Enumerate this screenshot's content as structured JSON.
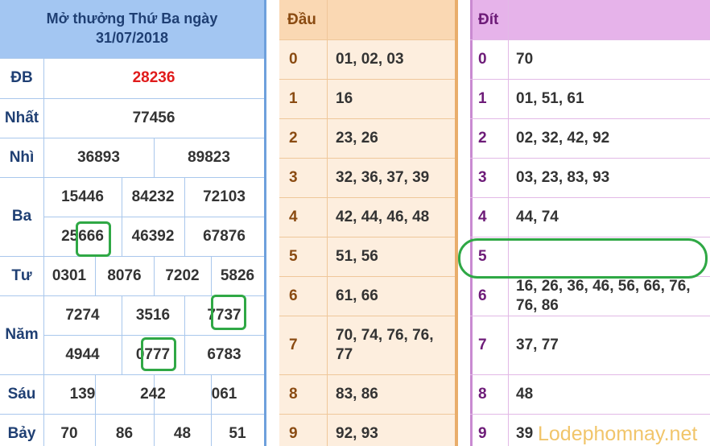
{
  "results": {
    "title_line1": "Mở thưởng Thứ Ba ngày",
    "title_line2": "31/07/2018",
    "special_label": "ĐB",
    "special_value": "28236",
    "first_label": "Nhất",
    "first_value": "77456",
    "second_label": "Nhì",
    "second_values": [
      "36893",
      "89823"
    ],
    "third_label": "Ba",
    "third_values": [
      "15446",
      "84232",
      "72103",
      "25666",
      "46392",
      "67876"
    ],
    "fourth_label": "Tư",
    "fourth_values": [
      "0301",
      "8076",
      "7202",
      "5826"
    ],
    "fifth_label": "Năm",
    "fifth_values": [
      "7274",
      "3516",
      "7737",
      "4944",
      "0777",
      "6783"
    ],
    "sixth_label": "Sáu",
    "sixth_values": [
      "139",
      "242",
      "061"
    ],
    "seventh_label": "Bảy",
    "seventh_values": [
      "70",
      "86",
      "48",
      "51"
    ],
    "special_color": "#e01b1b"
  },
  "dau": {
    "header": "Đầu",
    "rows": [
      {
        "k": "0",
        "v": "01, 02, 03"
      },
      {
        "k": "1",
        "v": "16"
      },
      {
        "k": "2",
        "v": "23, 26"
      },
      {
        "k": "3",
        "v": "32, 36, 37, 39"
      },
      {
        "k": "4",
        "v": "42, 44, 46, 48"
      },
      {
        "k": "5",
        "v": "51, 56"
      },
      {
        "k": "6",
        "v": "61, 66"
      },
      {
        "k": "7",
        "v": "70, 74, 76, 76,\n77"
      },
      {
        "k": "8",
        "v": "83, 86"
      },
      {
        "k": "9",
        "v": "92, 93"
      }
    ]
  },
  "dit": {
    "header": "Đít",
    "rows": [
      {
        "k": "0",
        "v": "70"
      },
      {
        "k": "1",
        "v": "01, 51, 61"
      },
      {
        "k": "2",
        "v": "02, 32, 42, 92"
      },
      {
        "k": "3",
        "v": "03, 23, 83, 93"
      },
      {
        "k": "4",
        "v": "44, 74"
      },
      {
        "k": "5",
        "v": ""
      },
      {
        "k": "6",
        "v": "16, 26, 36, 46, 56, 66, 76,\n76, 86"
      },
      {
        "k": "7",
        "v": "37, 77"
      },
      {
        "k": "8",
        "v": "48"
      },
      {
        "k": "9",
        "v": "39"
      }
    ]
  },
  "watermark": "Lodephomnay.net"
}
